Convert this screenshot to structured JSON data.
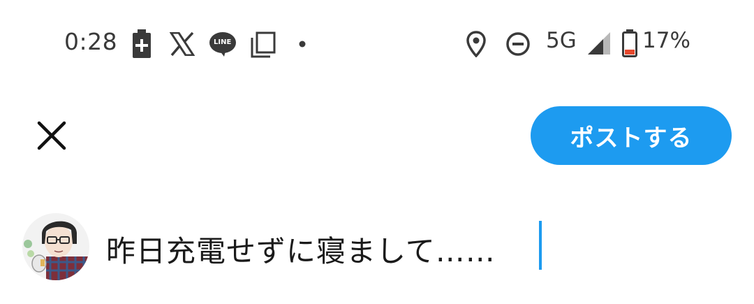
{
  "status_bar": {
    "time": "0:28",
    "network": "5G",
    "battery_percent": "17%",
    "icons": [
      "battery-saver-icon",
      "x-app-icon",
      "line-app-icon",
      "copy-icon",
      "dot-icon",
      "location-icon",
      "do-not-disturb-icon",
      "signal-icon",
      "battery-icon"
    ],
    "line_icon_text": "LINE"
  },
  "compose": {
    "close_icon": "close-icon",
    "post_button_label": "ポストする",
    "text": "昨日充電せずに寝まして……",
    "accent_color": "#1d9bf0"
  }
}
